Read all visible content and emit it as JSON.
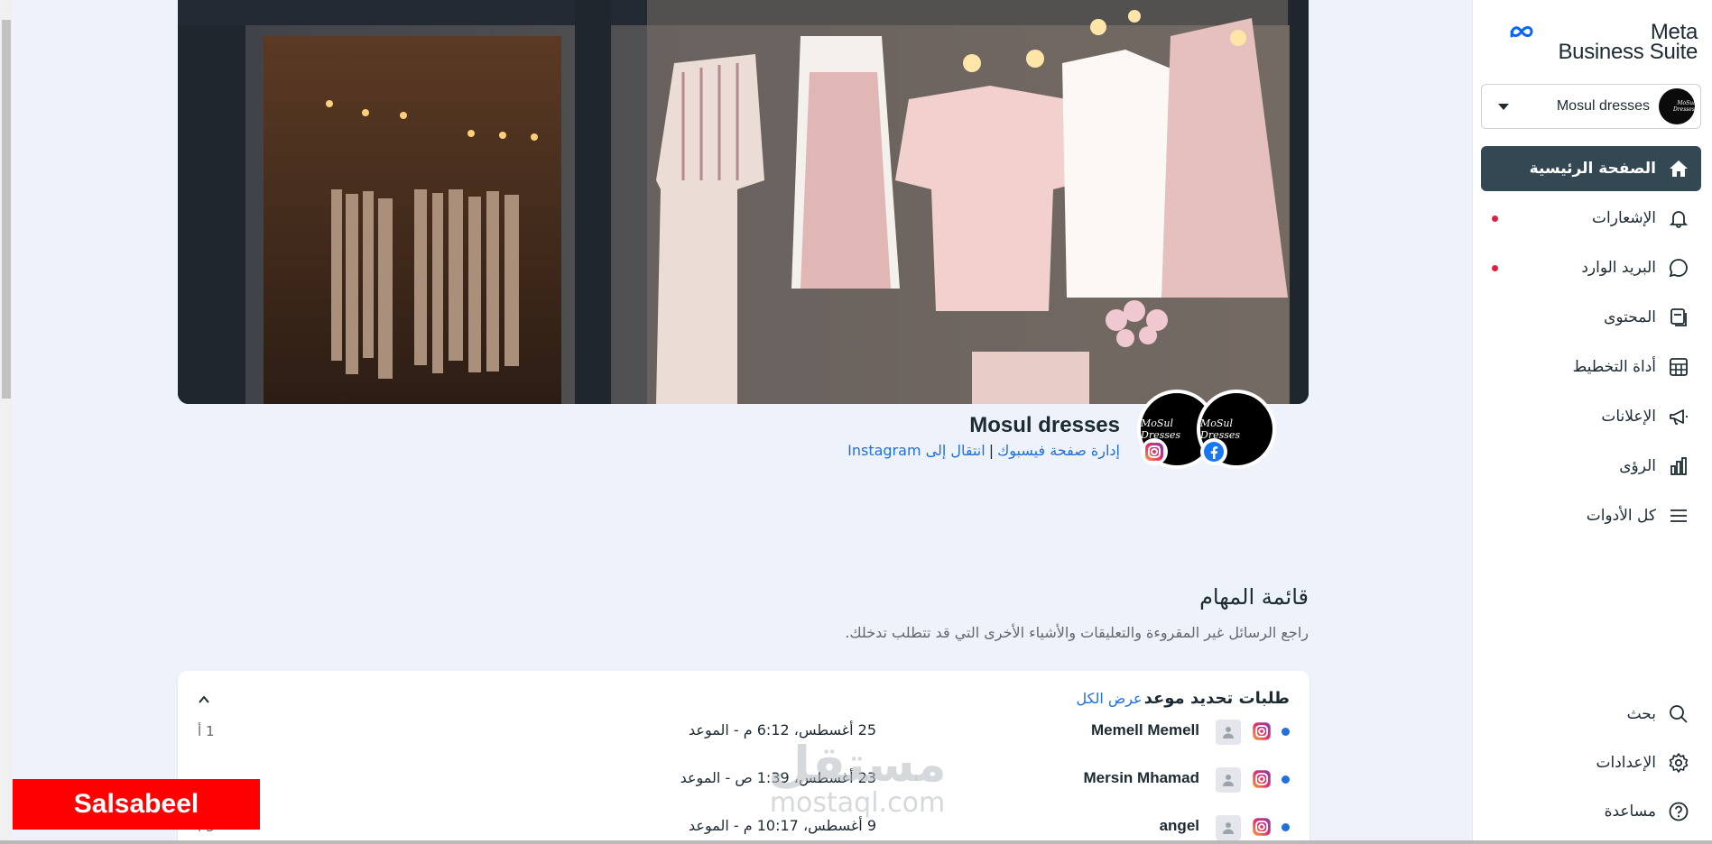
{
  "app": {
    "logo_line1": "Meta",
    "logo_line2": "Business Suite"
  },
  "account": {
    "name": "Mosul dresses"
  },
  "sidebar": {
    "items": [
      {
        "label": "الصفحة الرئيسية",
        "icon": "home-icon",
        "active": true
      },
      {
        "label": "الإشعارات",
        "icon": "bell-icon",
        "badge": true
      },
      {
        "label": "البريد الوارد",
        "icon": "chat-bubble-icon",
        "badge": true
      },
      {
        "label": "المحتوى",
        "icon": "content-icon"
      },
      {
        "label": "أداة التخطيط",
        "icon": "calendar-grid-icon"
      },
      {
        "label": "الإعلانات",
        "icon": "megaphone-icon"
      },
      {
        "label": "الرؤى",
        "icon": "bar-chart-icon"
      },
      {
        "label": "كل الأدوات",
        "icon": "menu-icon"
      }
    ],
    "bottom": [
      {
        "label": "بحث",
        "icon": "search-icon"
      },
      {
        "label": "الإعدادات",
        "icon": "gear-icon"
      },
      {
        "label": "مساعدة",
        "icon": "help-icon"
      }
    ]
  },
  "page": {
    "name": "Mosul dresses",
    "link_facebook": "إدارة صفحة فيسبوك",
    "link_separator": "|",
    "link_instagram": "انتقال إلى Instagram",
    "avatar_text": "MoSul Dresses"
  },
  "tasks": {
    "title": "قائمة المهام",
    "subtitle": "راجع الرسائل غير المقروءة والتعليقات والأشياء الأخرى التي قد تتطلب تدخلك.",
    "card_title": "طلبات تحديد موعد",
    "see_all": "عرض الكل",
    "rows": [
      {
        "name": "Memell Memell",
        "date": "25 أغسطس، 6:12 م - الموعد",
        "count": "1 أ"
      },
      {
        "name": "Mersin Mhamad",
        "date": "23 أغسطس، 1:39 ص - الموعد",
        "count": ""
      },
      {
        "name": "angel",
        "date": "9 أغسطس، 10:17 م - الموعد",
        "count": "3 أ"
      }
    ]
  },
  "overlay": {
    "watermark_line1": "مستقل",
    "watermark_line2": "mostaql.com",
    "name_tag": "Salsabeel"
  },
  "colors": {
    "accent": "#216fdb",
    "active_nav": "#344854",
    "badge": "#e41e3f",
    "name_tag": "#ff0000"
  }
}
